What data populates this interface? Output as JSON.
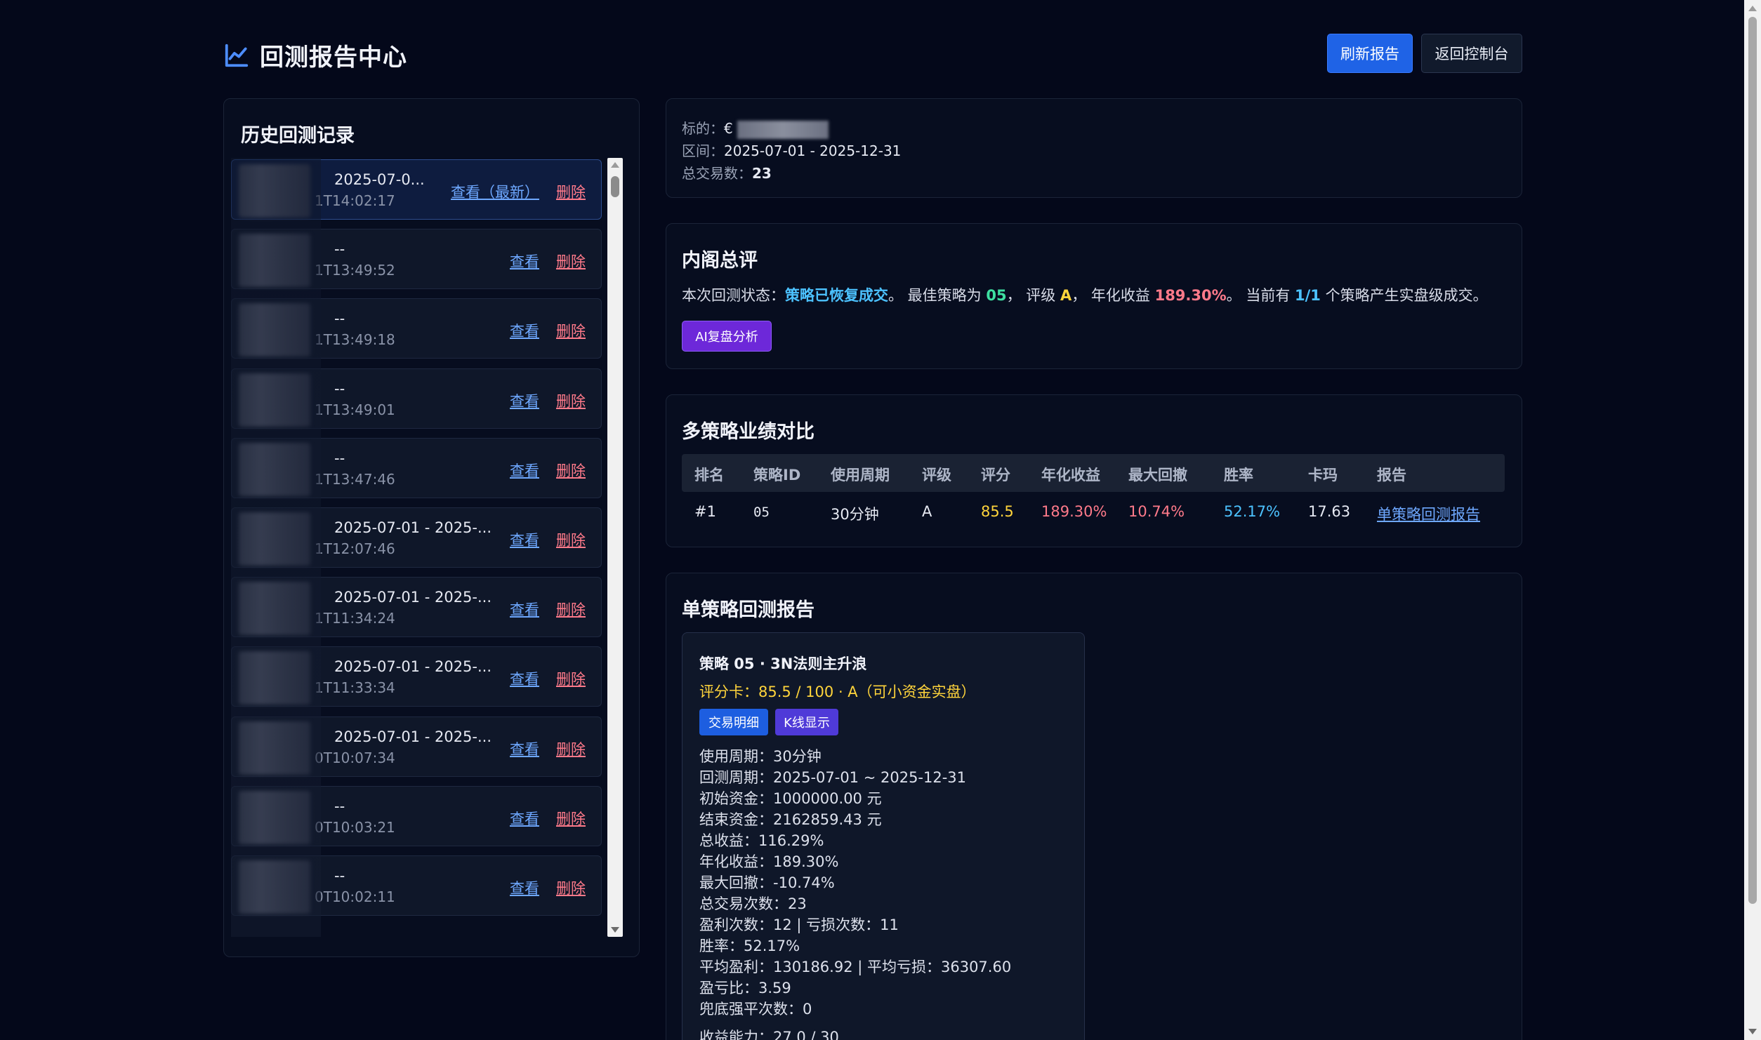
{
  "header": {
    "title": "回测报告中心",
    "refresh_label": "刷新报告",
    "back_label": "返回控制台"
  },
  "history": {
    "title": "历史回测记录",
    "items": [
      {
        "line1": "2025-07-0...",
        "line2": "1T14:02:17",
        "view": "查看（最新）",
        "del": "删除"
      },
      {
        "line1": "--",
        "line2": "1T13:49:52",
        "view": "查看",
        "del": "删除"
      },
      {
        "line1": "--",
        "line2": "1T13:49:18",
        "view": "查看",
        "del": "删除"
      },
      {
        "line1": "--",
        "line2": "1T13:49:01",
        "view": "查看",
        "del": "删除"
      },
      {
        "line1": "--",
        "line2": "1T13:47:46",
        "view": "查看",
        "del": "删除"
      },
      {
        "line1": "2025-07-01 - 2025-...",
        "line2": "1T12:07:46",
        "view": "查看",
        "del": "删除"
      },
      {
        "line1": "2025-07-01 - 2025-...",
        "line2": "1T11:34:24",
        "view": "查看",
        "del": "删除"
      },
      {
        "line1": "2025-07-01 - 2025-...",
        "line2": "1T11:33:34",
        "view": "查看",
        "del": "删除"
      },
      {
        "line1": "2025-07-01 - 2025-...",
        "line2": "0T10:07:34",
        "view": "查看",
        "del": "删除"
      },
      {
        "line1": "--",
        "line2": "0T10:03:21",
        "view": "查看",
        "del": "删除"
      },
      {
        "line1": "--",
        "line2": "0T10:02:11",
        "view": "查看",
        "del": "删除"
      }
    ]
  },
  "info": {
    "target_label": "标的：",
    "target_value": "€",
    "range_label": "区间：",
    "range_value": "2025-07-01 - 2025-12-31",
    "trades_label": "总交易数：",
    "trades_value": "23"
  },
  "summary": {
    "title": "内阁总评",
    "prefix": "本次回测状态：",
    "status": "策略已恢复成交",
    "t1": "。  最佳策略为 ",
    "best": "05",
    "t2": "，  评级 ",
    "grade": "A",
    "t3": "，  年化收益 ",
    "annual": "189.30%",
    "t4": "。  当前有 ",
    "count": "1/1",
    "t5": " 个策略产生实盘级成交。",
    "ai_button": "AI复盘分析"
  },
  "comparison": {
    "title": "多策略业绩对比",
    "headers": [
      "排名",
      "策略ID",
      "使用周期",
      "评级",
      "评分",
      "年化收益",
      "最大回撤",
      "胜率",
      "卡玛",
      "报告"
    ],
    "row": [
      "#1",
      "05",
      "30分钟",
      "A",
      "85.5",
      "189.30%",
      "10.74%",
      "52.17%",
      "17.63",
      "单策略回测报告"
    ]
  },
  "report": {
    "title": "单策略回测报告",
    "card_title": "策略 05 · 3N法则主升浪",
    "score": "评分卡：85.5 / 100 · A（可小资金实盘）",
    "tag_trades": "交易明细",
    "tag_kline": "K线显示",
    "details": [
      "使用周期：30分钟",
      "回测周期：2025-07-01 ~ 2025-12-31",
      "初始资金：1000000.00 元",
      "结束资金：2162859.43 元",
      "总收益：116.29%",
      "年化收益：189.30%",
      "最大回撤：-10.74%",
      "总交易次数：23",
      "盈利次数：12 | 亏损次数：11",
      "胜率：52.17%",
      "平均盈利：130186.92 | 平均亏损：36307.60",
      "盈亏比：3.59",
      "兜底强平次数：0",
      "收益能力：27.0 / 30"
    ]
  },
  "colors": {
    "accent": "#1f63e6",
    "positive": "#3ee0a1",
    "negative": "#ff7a8a",
    "highlight": "#ffd43b",
    "info": "#4cc2ff"
  }
}
